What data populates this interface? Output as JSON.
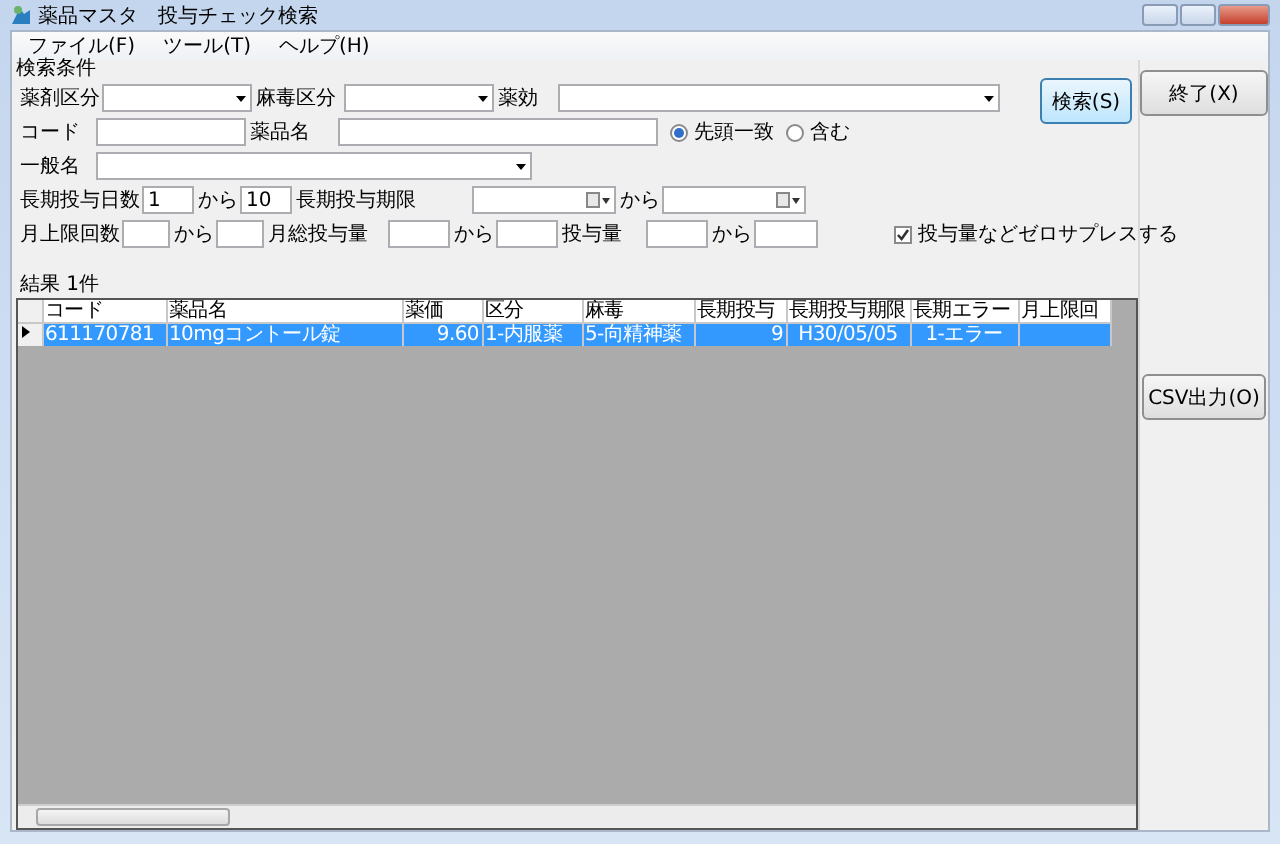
{
  "window": {
    "title": "薬品マスタ　投与チェック検索"
  },
  "menu": [
    "ファイル(F)",
    "ツール(T)",
    "ヘルプ(H)"
  ],
  "criteria": {
    "title": "検索条件",
    "rows": [
      {
        "items": [
          {
            "kind": "label",
            "text": "薬剤区分"
          },
          {
            "kind": "combo"
          },
          {
            "kind": "label",
            "text": "麻毒区分"
          },
          {
            "kind": "combo"
          },
          {
            "kind": "label",
            "text": "薬効"
          },
          {
            "kind": "combo"
          }
        ]
      },
      {
        "items": [
          {
            "kind": "label",
            "text": "コード"
          },
          {
            "kind": "text"
          },
          {
            "kind": "label",
            "text": "薬品名"
          },
          {
            "kind": "text"
          },
          {
            "kind": "radio",
            "label": "先頭一致",
            "selected": true
          },
          {
            "kind": "radio",
            "label": "含む",
            "selected": false
          }
        ]
      },
      {
        "items": [
          {
            "kind": "label",
            "text": "一般名"
          },
          {
            "kind": "combo"
          }
        ]
      },
      {
        "items": [
          {
            "kind": "label",
            "text": "長期投与日数"
          },
          {
            "kind": "text",
            "value": "1"
          },
          {
            "kind": "label",
            "text": "から"
          },
          {
            "kind": "text",
            "value": "10"
          },
          {
            "kind": "label",
            "text": "長期投与期限"
          },
          {
            "kind": "date"
          },
          {
            "kind": "label",
            "text": "から"
          },
          {
            "kind": "date"
          }
        ]
      },
      {
        "items": [
          {
            "kind": "label",
            "text": "月上限回数"
          },
          {
            "kind": "text"
          },
          {
            "kind": "label",
            "text": "から"
          },
          {
            "kind": "text"
          },
          {
            "kind": "label",
            "text": "月総投与量"
          },
          {
            "kind": "text"
          },
          {
            "kind": "label",
            "text": "から"
          },
          {
            "kind": "text"
          },
          {
            "kind": "label",
            "text": "投与量"
          },
          {
            "kind": "text"
          },
          {
            "kind": "label",
            "text": "から"
          },
          {
            "kind": "text"
          },
          {
            "kind": "checkbox",
            "label": "投与量などゼロサプレスする",
            "checked": true
          }
        ]
      }
    ],
    "search_button": "検索(S)"
  },
  "result": {
    "label": "結果 1件",
    "columns": [
      "コード",
      "薬品名",
      "薬価",
      "区分",
      "麻毒",
      "長期投与",
      "長期投与期限",
      "長期エラー",
      "月上限回"
    ],
    "rows": [
      {
        "selected": true,
        "cells": [
          "611170781",
          "10mgコントール錠",
          "9.60",
          "1-内服薬",
          "5-向精神薬",
          "9",
          "H30/05/05",
          "1-エラー",
          ""
        ]
      }
    ]
  },
  "side_buttons": [
    "終了(X)",
    "CSV出力(O)"
  ]
}
